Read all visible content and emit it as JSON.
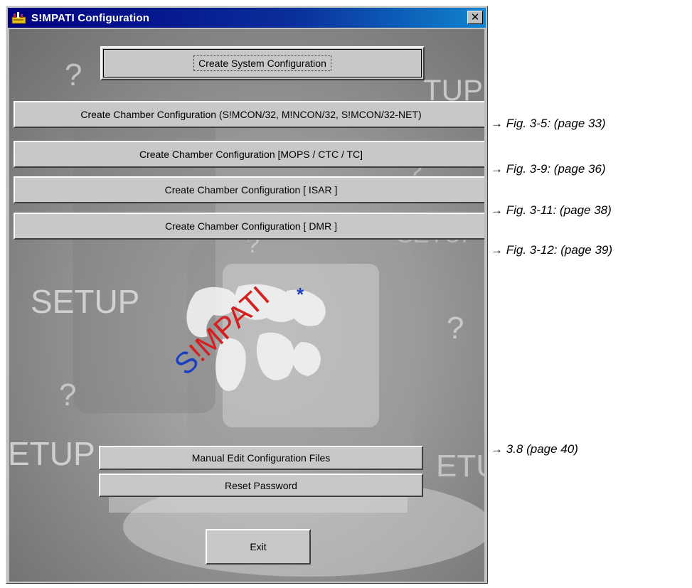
{
  "window": {
    "title": "S!MPATI  Configuration",
    "close_label": "✕"
  },
  "buttons": {
    "create_system": "Create System Configuration",
    "chamber_simcon": "Create Chamber Configuration (S!MCON/32, M!NCON/32, S!MCON/32-NET)",
    "chamber_mops": "Create Chamber Configuration [MOPS / CTC / TC]",
    "chamber_isar": "Create Chamber Configuration [ ISAR ]",
    "chamber_dmr": "Create Chamber Configuration [ DMR ]",
    "manual_edit": "Manual Edit Configuration Files",
    "reset_password": "Reset Password",
    "exit": "Exit"
  },
  "annotations": [
    "→ Fig. 3-5:  (page 33)",
    "→ Fig. 3-9:  (page 36)",
    "→ Fig. 3-11:  (page 38)",
    "→ Fig. 3-12:  (page 39)",
    "→ 3.8 (page 40)"
  ],
  "background": {
    "words": [
      "SETUP",
      "SETUP",
      "ETUP",
      "ETU",
      "TUP"
    ],
    "question_marks": [
      "?",
      "?",
      "?",
      "?",
      "?"
    ]
  },
  "logo": {
    "text": "S!MPATI",
    "star": "*",
    "colors": {
      "s": "#1a3fbf",
      "rest": "#d42020",
      "star": "#1a3fbf"
    }
  },
  "colors": {
    "titlebar_start": "#000080",
    "titlebar_end": "#1084d0",
    "face": "#c0c0c0"
  }
}
